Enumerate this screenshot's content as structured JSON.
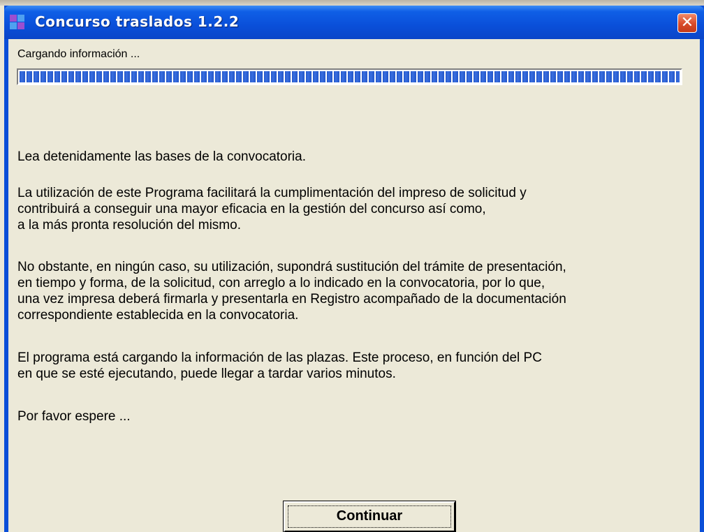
{
  "window": {
    "title": "Concurso traslados 1.2.2",
    "close_label": "✕"
  },
  "status": {
    "text": "Cargando información ...",
    "progress_fraction": 1.0
  },
  "message": {
    "p1": "Lea detenidamente las bases de la convocatoria.",
    "p2": "La utilización de este Programa facilitará la cumplimentación del impreso de solicitud y\ncontribuirá a conseguir una mayor eficacia en la gestión del concurso así como,\na la más pronta resolución del mismo.",
    "p3": "No obstante, en ningún caso, su utilización, supondrá sustitución del trámite de presentación,\nen tiempo y forma, de la solicitud, con arreglo a lo indicado en la convocatoria, por lo que,\nuna vez impresa deberá firmarla y presentarla en Registro acompañado de la documentación\ncorrespondiente establecida en la convocatoria.",
    "p4": "El programa está cargando la información de las plazas. Este proceso, en función del PC\nen que se esté ejecutando, puede llegar a tardar varios minutos.",
    "p5": "Por favor espere ..."
  },
  "buttons": {
    "continue_label": "Continuar"
  },
  "colors": {
    "titlebar": "#0a4fd9",
    "progress_fill": "#2356c9",
    "background": "#ece9d8"
  }
}
